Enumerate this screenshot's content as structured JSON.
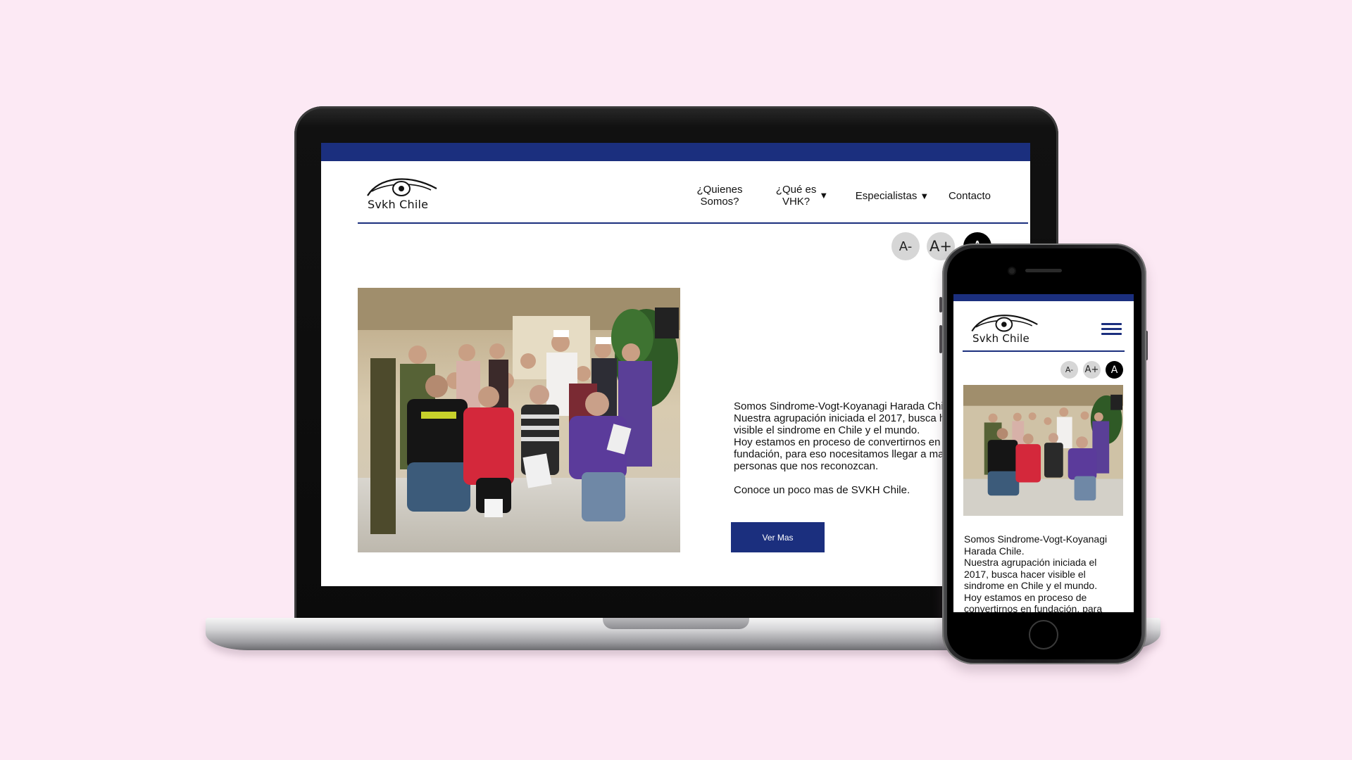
{
  "laptop": {
    "logo_text": "Svkh Chile",
    "nav": [
      {
        "label": "¿Quienes\nSomos?",
        "has_dropdown": false
      },
      {
        "label": "¿Qué es\nVHK?",
        "has_dropdown": true
      },
      {
        "label": "Especialistas",
        "has_dropdown": true
      },
      {
        "label": "Contacto",
        "has_dropdown": false
      }
    ],
    "dropdown_caret": "▼",
    "font_controls": {
      "decrease": "A-",
      "increase": "A+",
      "reset": "A"
    },
    "intro_lines": [
      "Somos Sindrome-Vogt-Koyanagi Harada Chile.",
      "Nuestra agrupación iniciada el 2017, busca hacer",
      "visible el sindrome en Chile y el mundo.",
      "Hoy estamos en proceso de convertirnos en",
      "fundación, para eso nocesitamos llegar a mas",
      "personas que nos reconozcan."
    ],
    "closing_line": "Conoce un poco mas de SVKH Chile.",
    "cta_label": "Ver Mas"
  },
  "phone": {
    "logo_text": "Svkh Chile",
    "menu_icon": "hamburger-icon",
    "font_controls": {
      "decrease": "A-",
      "increase": "A+",
      "reset": "A"
    },
    "intro_lines": [
      "Somos Sindrome-Vogt-Koyanagi",
      "Harada Chile.",
      "Nuestra agrupación iniciada el",
      "2017, busca hacer visible el",
      "sindrome en Chile y el mundo.",
      "Hoy estamos en proceso de",
      "convertirnos en fundación, para"
    ]
  },
  "colors": {
    "background": "#fce9f4",
    "brand_navy": "#1b2f7e",
    "button_grey": "#d6d6d6",
    "button_black": "#000000"
  }
}
